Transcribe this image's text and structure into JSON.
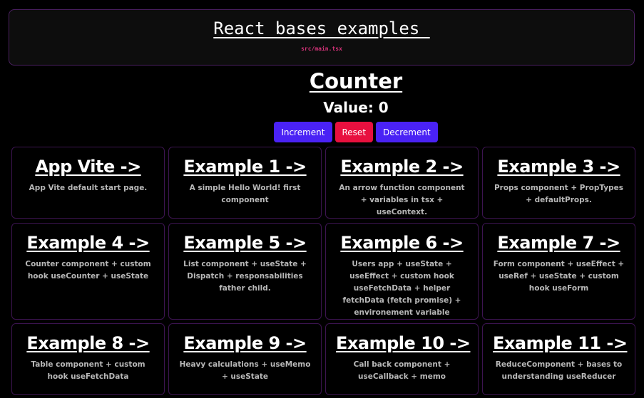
{
  "header": {
    "title": "React bases examples ",
    "file": "src/main.tsx"
  },
  "counter": {
    "title": "Counter",
    "value_text": "Value: 0",
    "buttons": {
      "increment": "Increment",
      "reset": "Reset",
      "decrement": "Decrement"
    }
  },
  "cards": [
    {
      "title": "App Vite ->",
      "desc": "App Vite default start page."
    },
    {
      "title": "Example 1 ->",
      "desc": "A simple Hello World! first component"
    },
    {
      "title": "Example 2 ->",
      "desc": "An arrow function component + variables in tsx + useContext."
    },
    {
      "title": "Example 3 ->",
      "desc": "Props component + PropTypes + defaultProps."
    },
    {
      "title": "Example 4 ->",
      "desc": "Counter component + custom hook useCounter + useState"
    },
    {
      "title": "Example 5 ->",
      "desc": "List component + useState + Dispatch + responsabilities father child."
    },
    {
      "title": "Example 6 ->",
      "desc": "Users app + useState + useEffect + custom hook useFetchData + helper fetchData (fetch promise) + environement variable"
    },
    {
      "title": "Example 7 ->",
      "desc": "Form component + useEffect + useRef + useState + custom hook useForm"
    },
    {
      "title": "Example 8 ->",
      "desc": "Table component + custom hook useFetchData"
    },
    {
      "title": "Example 9 ->",
      "desc": "Heavy calculations + useMemo + useState"
    },
    {
      "title": "Example 10 ->",
      "desc": "Call back component + useCallback + memo"
    },
    {
      "title": "Example 11 ->",
      "desc": "ReduceComponent + bases to understanding useReducer"
    }
  ],
  "colors": {
    "background": "#000000",
    "button_primary": "#4a22f5",
    "button_reset": "#e8103f",
    "card_border": "#3c1450",
    "file_label": "#d6337a"
  }
}
